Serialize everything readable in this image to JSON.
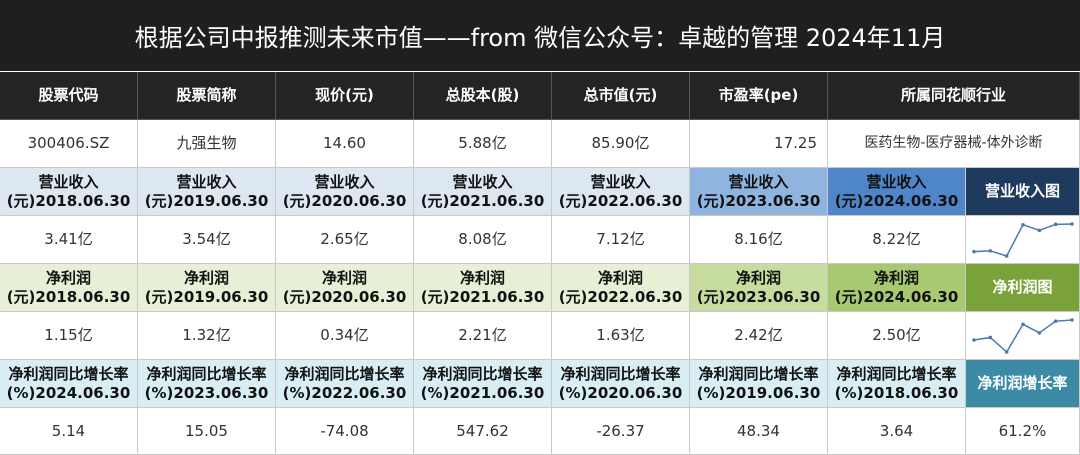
{
  "title": "根据公司中报推测未来市值——from 微信公众号：卓越的管理   2024年11月",
  "headers": [
    "股票代码",
    "股票简称",
    "现价(元)",
    "总股本(股)",
    "总市值(元)",
    "市盈率(pe)",
    "所属同花顺行业"
  ],
  "stock": {
    "code": "300406.SZ",
    "name": "九强生物",
    "price": "14.60",
    "shares": "5.88亿",
    "market_cap": "85.90亿",
    "pe": "17.25",
    "industry": "医药生物-医疗器械-体外诊断"
  },
  "revenue": {
    "label": "营业收入",
    "periods": [
      "(元)2018.06.30",
      "(元)2019.06.30",
      "(元)2020.06.30",
      "(元)2021.06.30",
      "(元)2022.06.30",
      "(元)2023.06.30",
      "(元)2024.06.30"
    ],
    "values": [
      "3.41亿",
      "3.54亿",
      "2.65亿",
      "8.08亿",
      "7.12亿",
      "8.16亿",
      "8.22亿"
    ],
    "chart_button": "营业收入图",
    "spark": [
      3.41,
      3.54,
      2.65,
      8.08,
      7.12,
      8.16,
      8.22
    ]
  },
  "net_profit": {
    "label": "净利润",
    "periods": [
      "(元)2018.06.30",
      "(元)2019.06.30",
      "(元)2020.06.30",
      "(元)2021.06.30",
      "(元)2022.06.30",
      "(元)2023.06.30",
      "(元)2024.06.30"
    ],
    "values": [
      "1.15亿",
      "1.32亿",
      "0.34亿",
      "2.21亿",
      "1.63亿",
      "2.42亿",
      "2.50亿"
    ],
    "chart_button": "净利润图",
    "spark": [
      1.15,
      1.32,
      0.34,
      2.21,
      1.63,
      2.42,
      2.5
    ]
  },
  "growth": {
    "label": "净利润同比增长率",
    "periods": [
      "(%)2024.06.30",
      "(%)2023.06.30",
      "(%)2022.06.30",
      "(%)2021.06.30",
      "(%)2020.06.30",
      "(%)2019.06.30",
      "(%)2018.06.30"
    ],
    "values": [
      "5.14",
      "15.05",
      "-74.08",
      "547.62",
      "-26.37",
      "48.34",
      "3.64"
    ],
    "button": "净利润增长率",
    "summary": "61.2%"
  },
  "colors": {
    "title_bg": "#1f1f1f",
    "revenue_accent": "#1f3a5f",
    "profit_accent": "#7aa23a",
    "growth_accent": "#3c8aa6",
    "spark_line": "#4a78b5"
  }
}
